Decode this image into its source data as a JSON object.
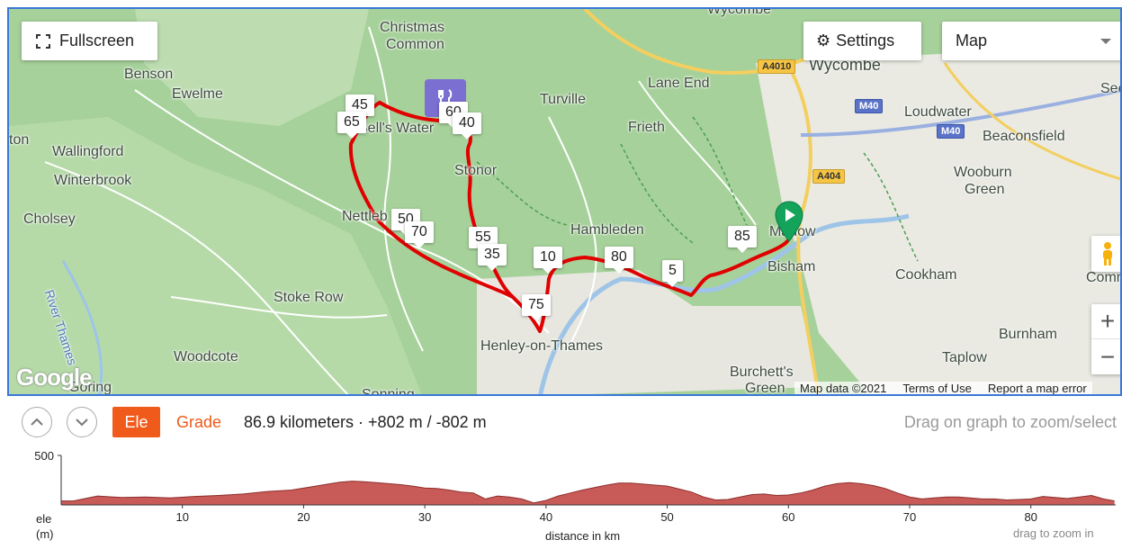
{
  "map": {
    "controls": {
      "fullscreen_label": "Fullscreen",
      "settings_label": "Settings",
      "map_type": "Map",
      "zoom_in": "+",
      "zoom_out": "−"
    },
    "places": [
      {
        "name": "Wycombe",
        "key": "wycombe-top"
      },
      {
        "name": "Christmas",
        "key": "christmas"
      },
      {
        "name": "Common",
        "key": "common"
      },
      {
        "name": "Benson",
        "key": "benson"
      },
      {
        "name": "Ewelme",
        "key": "ewelme"
      },
      {
        "name": "Turville",
        "key": "turville"
      },
      {
        "name": "Lane End",
        "key": "lane-end"
      },
      {
        "name": "Wycombe",
        "key": "wycombe"
      },
      {
        "name": "Loudwater",
        "key": "loudwater"
      },
      {
        "name": "Wallingford",
        "key": "wallingford"
      },
      {
        "name": "Frieth",
        "key": "frieth"
      },
      {
        "name": "Beaconsfield",
        "key": "beaconsfield"
      },
      {
        "name": "Winterbrook",
        "key": "winterbrook"
      },
      {
        "name": "Stonor",
        "key": "stonor"
      },
      {
        "name": "Wooburn",
        "key": "wooburn"
      },
      {
        "name": "Green",
        "key": "wooburn-green"
      },
      {
        "name": "Cholsey",
        "key": "cholsey"
      },
      {
        "name": "Nettleb",
        "key": "nettlebed"
      },
      {
        "name": "Hambleden",
        "key": "hambleden"
      },
      {
        "name": "Marlow",
        "key": "marlow"
      },
      {
        "name": "Bisham",
        "key": "bisham"
      },
      {
        "name": "Cookham",
        "key": "cookham"
      },
      {
        "name": "River Thames",
        "key": "river-thames"
      },
      {
        "name": "Stoke Row",
        "key": "stoke-row"
      },
      {
        "name": "Henley-on-Thames",
        "key": "henley"
      },
      {
        "name": "Burnham",
        "key": "burnham"
      },
      {
        "name": "Woodcote",
        "key": "woodcote"
      },
      {
        "name": "Taplow",
        "key": "taplow"
      },
      {
        "name": "Burchett's",
        "key": "burchetts"
      },
      {
        "name": "Green",
        "key": "burchetts-green"
      },
      {
        "name": "Goring",
        "key": "goring"
      },
      {
        "name": "Sonning",
        "key": "sonning"
      },
      {
        "name": "Bell's Water",
        "key": "bells-water"
      },
      {
        "name": "ton",
        "key": "ton"
      },
      {
        "name": "Comm",
        "key": "comm"
      },
      {
        "name": "Seer",
        "key": "seer"
      }
    ],
    "roads": [
      "A4010",
      "M40",
      "M40",
      "A404"
    ],
    "km_markers": [
      "45",
      "65",
      "60",
      "40",
      "50",
      "70",
      "55",
      "35",
      "10",
      "80",
      "5",
      "85",
      "75"
    ],
    "attribution": {
      "map_data": "Map data ©2021",
      "terms": "Terms of Use",
      "report": "Report a map error"
    },
    "google_logo": "Google"
  },
  "elevation": {
    "ele_tab": "Ele",
    "grade_tab": "Grade",
    "stats": "86.9 kilometers · +802 m / -802 m",
    "hint": "Drag on graph to zoom/select",
    "y_label_line1": "ele",
    "y_label_line2": "(m)",
    "x_label": "distance in km",
    "zoom_hint": "drag to zoom in",
    "fill_color": "#c85a57"
  },
  "chart_data": {
    "type": "area",
    "xlabel": "distance in km",
    "ylabel": "ele (m)",
    "xlim": [
      0,
      87
    ],
    "ylim": [
      0,
      500
    ],
    "y_ticks": [
      500
    ],
    "x_ticks": [
      10,
      20,
      30,
      40,
      50,
      60,
      70,
      80
    ],
    "x": [
      0,
      1,
      2,
      3,
      5,
      7,
      9,
      11,
      13,
      15,
      17,
      19,
      21,
      22,
      23,
      24,
      25,
      26,
      27,
      28,
      29,
      30,
      31,
      32,
      33,
      34,
      35,
      36,
      37,
      38,
      39,
      40,
      41,
      42,
      43,
      44,
      45,
      46,
      47,
      48,
      49,
      50,
      51,
      52,
      53,
      54,
      55,
      56,
      57,
      58,
      59,
      60,
      61,
      62,
      63,
      64,
      65,
      66,
      67,
      68,
      69,
      70,
      71,
      72,
      73,
      74,
      75,
      76,
      77,
      78,
      79,
      80,
      81,
      82,
      83,
      84,
      85,
      86,
      86.9
    ],
    "y": [
      40,
      40,
      65,
      90,
      75,
      80,
      70,
      85,
      95,
      110,
      135,
      150,
      190,
      210,
      230,
      240,
      235,
      225,
      215,
      205,
      190,
      170,
      165,
      150,
      130,
      120,
      60,
      90,
      80,
      60,
      20,
      45,
      90,
      120,
      150,
      175,
      200,
      220,
      220,
      210,
      200,
      190,
      160,
      130,
      80,
      50,
      55,
      80,
      105,
      110,
      95,
      100,
      120,
      150,
      190,
      215,
      225,
      215,
      195,
      165,
      120,
      80,
      60,
      70,
      80,
      80,
      70,
      60,
      60,
      50,
      55,
      60,
      85,
      75,
      65,
      80,
      95,
      60,
      40
    ]
  }
}
